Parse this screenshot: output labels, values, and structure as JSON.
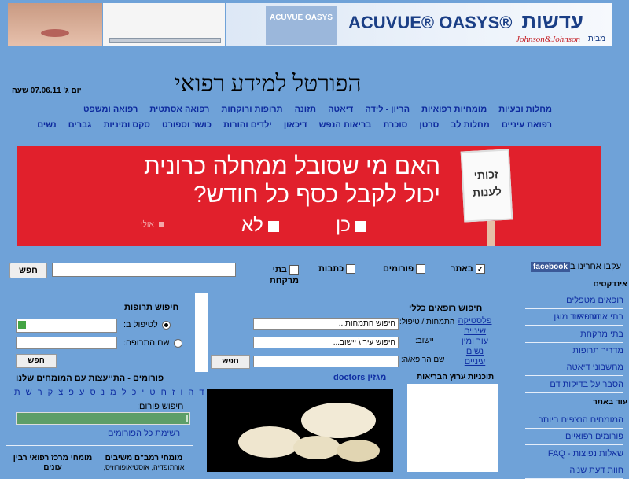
{
  "banner": {
    "product_box": "ACUVUE OASYS",
    "brand": "ACUVUE® OASYS®",
    "hebrew": "עדשות",
    "maker": "Johnson&Johnson",
    "by": "מבית"
  },
  "header": {
    "date": "יום ג' 07.06.11 שעה",
    "title": "הפורטל למידע רפואי"
  },
  "nav": {
    "row1": [
      "מחלות ובעיות",
      "מומחיות רפואיות",
      "הריון - לידה",
      "דיאטה",
      "תזונה",
      "תרופות ורוקחות",
      "רפואה אסתטית",
      "רפואה ומשפט"
    ],
    "row2": [
      "רפואת עיניים",
      "מחלות לב",
      "סרטן",
      "סוכרת",
      "בריאות הנפש",
      "דיכאון",
      "ילדים והורות",
      "כושר וספורט",
      "סקס ומיניות",
      "גברים",
      "נשים"
    ]
  },
  "red_ad": {
    "sign": "זכותי לענות",
    "question1": "האם מי שסובל ממחלה כרונית",
    "question2": "יכול לקבל כסף כל חודש?",
    "yes": "כן",
    "no": "לא",
    "maybe": "אולי"
  },
  "search": {
    "button": "חפש",
    "options": [
      {
        "label": "באתר",
        "checked": true
      },
      {
        "label": "פורומים",
        "checked": false
      },
      {
        "label": "כתבות",
        "checked": false
      },
      {
        "label": "בתי מרקחת",
        "checked": false
      }
    ]
  },
  "sidebar": {
    "follow": "עקבו אחרינו ב",
    "facebook": "facebook",
    "index_title": "אינדקסים",
    "index_items": [
      "רופאים מטפלים",
      "מרפאות",
      "בתי אבות ודיור מוגן",
      "בתי מרקחת",
      "מדריך תרופות",
      "מחשבוני דיאטה",
      "הסבר על בדיקות דם"
    ],
    "more_title": "עוד באתר",
    "more_items": [
      "המומחים הנצפים ביותר",
      "פורומים רפואיים",
      "שאלות נפוצות - FAQ",
      "חוות דעת שניה"
    ]
  },
  "doctor_search": {
    "title": "חיפוש רופאים כללי",
    "specialty_label": "התמחות / טיפול:",
    "specialty_placeholder": "חיפוש התמחות...",
    "city_label": "יישוב:",
    "city_placeholder": "חיפוש עיר \\ יישוב...",
    "name_label": "שם הרופא/ה:",
    "button": "חפש",
    "links": [
      "פלסטיקה",
      "שיניים",
      "עור ומין",
      "נשים",
      "עיניים"
    ]
  },
  "drug_search": {
    "title": "חיפוש תרופות",
    "opt_treat": "לטיפול ב:",
    "opt_name": "שם התרופה:",
    "button": "חפש"
  },
  "forums": {
    "title": "פורומים - התייעצות עם המומחים שלנו",
    "alphabet": "א ב ג ד ה ו ז ח ט י כ ל מ נ ס ע פ צ ק ר ש ת",
    "search_label": "חיפוש פורום:",
    "list_link": "רשימת כל הפורומים"
  },
  "experts": {
    "ramam": "מומחי רמב\"ם משיבים",
    "ramam_sub": "אורתופדיה, אוסטיאופורוזיס,",
    "rabin": "מומחי מרכז רפואי רבין עונים"
  },
  "magazine": {
    "title": "מגזין doctors"
  },
  "health_programs": {
    "title": "תוכניות ערוץ הבריאות"
  },
  "colors": {
    "background": "#6fa2d8",
    "nav_link": "#0d2a9e",
    "red_ad": "#e1202c"
  }
}
